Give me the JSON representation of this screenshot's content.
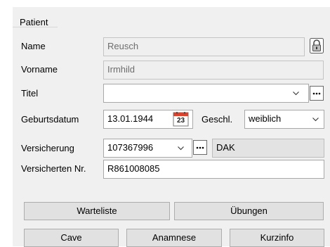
{
  "group": {
    "title": "Patient"
  },
  "fields": {
    "name": {
      "label": "Name",
      "value": "Reusch"
    },
    "vorname": {
      "label": "Vorname",
      "value": "Irmhild"
    },
    "titel": {
      "label": "Titel",
      "value": ""
    },
    "geburtsdatum": {
      "label": "Geburtsdatum",
      "value": "13.01.1944",
      "calendar_day": "23"
    },
    "geschlecht": {
      "label": "Geschl.",
      "value": "weiblich"
    },
    "versicherung": {
      "label": "Versicherung",
      "value": "107367996",
      "name_value": "DAK"
    },
    "versicherten_nr": {
      "label": "Versicherten Nr.",
      "value": "R861008085"
    }
  },
  "buttons": {
    "warteliste": "Warteliste",
    "uebungen": "Übungen",
    "cave": "Cave",
    "anamnese": "Anamnese",
    "kurzinfo": "Kurzinfo"
  },
  "icons": {
    "lock": "padlock-icon",
    "calendar": "calendar-icon",
    "dropdown": "chevron-down-icon",
    "more": "ellipsis-icon"
  },
  "colors": {
    "panel_bg": "#f0f0f0",
    "readonly_bg": "#efefef",
    "calendar_red": "#d9432e",
    "button_bg": "#e1e1e1"
  }
}
